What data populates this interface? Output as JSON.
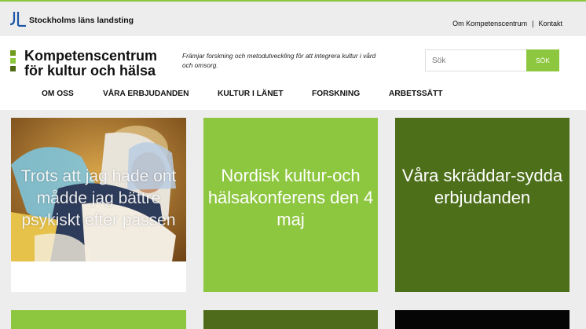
{
  "topbar": {
    "county_name": "Stockholms läns landsting",
    "links": [
      "Om Kompetenscentrum",
      "Kontakt"
    ],
    "separator": "|"
  },
  "header": {
    "brand_line1": "Kompetenscentrum",
    "brand_line2": "för kultur och hälsa",
    "tagline": "Främjar forskning och metodutveckling för att integrera kultur i vård och omsorg."
  },
  "search": {
    "placeholder": "Sök",
    "button_label": "SÖK"
  },
  "nav": {
    "items": [
      "OM OSS",
      "VÅRA ERBJUDANDEN",
      "KULTUR I LÄNET",
      "FORSKNING",
      "ARBETSSÄTT"
    ]
  },
  "tiles": [
    {
      "text": "Trots att jag hade ont mådde jag bättre psykiskt efter passen",
      "color": "#ffffff"
    },
    {
      "text": "Nordisk kultur-och hälsakonferens den 4 maj",
      "color": "#8dc63f"
    },
    {
      "text": "Våra skräddar-sydda erbjudanden",
      "color": "#4d6f1a"
    },
    {
      "color": "#8dc63f"
    },
    {
      "color": "#4d6b1a"
    },
    {
      "color": "#050505"
    }
  ],
  "colors": {
    "accent": "#8dc63f",
    "dark_green": "#4d6f1a",
    "background": "#ededed"
  }
}
